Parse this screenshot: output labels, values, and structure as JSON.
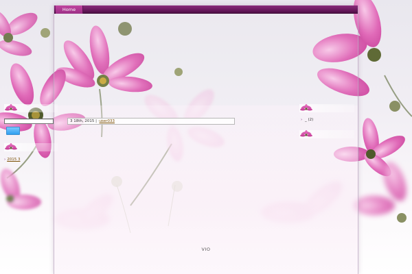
{
  "nav": {
    "home_label": "Home"
  },
  "sidebar_left": {
    "search": {
      "input_value": "",
      "button_label": ""
    },
    "archive": {
      "link_text": "2015 3"
    }
  },
  "post": {
    "date_text": "3 18th, 2015 |",
    "author_prefix": "·",
    "author_text": "user033"
  },
  "sidebar_right": {
    "category": {
      "arrow": "›",
      "text": "_ (2)"
    }
  },
  "footer": {
    "text": "VIO"
  },
  "colors": {
    "nav_bar": "#6a1a5e",
    "nav_item": "#b03d94",
    "search_button": "#2ea0f0",
    "link": "#7a4d00",
    "flower_pink": "#e05fb5"
  },
  "icons": {
    "widget_title_icon": "flower-icon",
    "list_bullet": "chevron-right-icon"
  }
}
